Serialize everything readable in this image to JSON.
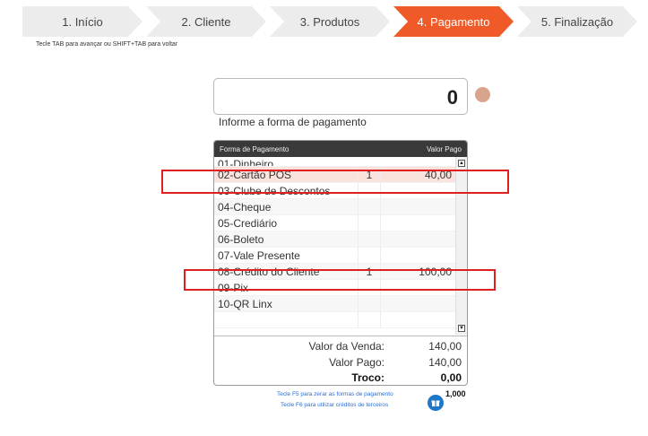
{
  "steps": [
    {
      "label": "1. Início",
      "active": false
    },
    {
      "label": "2. Cliente",
      "active": false
    },
    {
      "label": "3. Produtos",
      "active": false
    },
    {
      "label": "4. Pagamento",
      "active": true
    },
    {
      "label": "5. Finalização",
      "active": false
    }
  ],
  "hint_top": "Tecle TAB para avançar ou SHIFT+TAB para voltar",
  "amount": {
    "value": "0"
  },
  "status_dot_color": "#d9a48c",
  "prompt": "Informe a forma de pagamento",
  "table": {
    "headers": {
      "method": "Forma de Pagamento",
      "paid": "Valor Pago"
    },
    "rows": [
      {
        "name": "01-Dinheiro",
        "qty": "",
        "value": ""
      },
      {
        "name": "02-Cartão POS",
        "qty": "1",
        "value": "40,00"
      },
      {
        "name": "03-Clube de Descontos",
        "qty": "",
        "value": ""
      },
      {
        "name": "04-Cheque",
        "qty": "",
        "value": ""
      },
      {
        "name": "05-Crediário",
        "qty": "",
        "value": ""
      },
      {
        "name": "06-Boleto",
        "qty": "",
        "value": ""
      },
      {
        "name": "07-Vale Presente",
        "qty": "",
        "value": ""
      },
      {
        "name": "08-Crédito do Cliente",
        "qty": "1",
        "value": "100,00"
      },
      {
        "name": "09-Pix",
        "qty": "",
        "value": ""
      },
      {
        "name": "10-QR Linx",
        "qty": "",
        "value": ""
      }
    ]
  },
  "totals": {
    "sale_label": "Valor da Venda:",
    "sale_value": "140,00",
    "paid_label": "Valor Pago:",
    "paid_value": "140,00",
    "change_label": "Troco:",
    "change_value": "0,00"
  },
  "hints_bottom": {
    "f5": "Tecle F5 para zerar as formas de pagamento",
    "f6": "Tecle F6 para utilizar créditos de terceiros"
  },
  "credit_value": "1,000",
  "colors": {
    "accent": "#f05a28",
    "highlight": "#e02020",
    "icon_blue": "#1e78c8"
  }
}
